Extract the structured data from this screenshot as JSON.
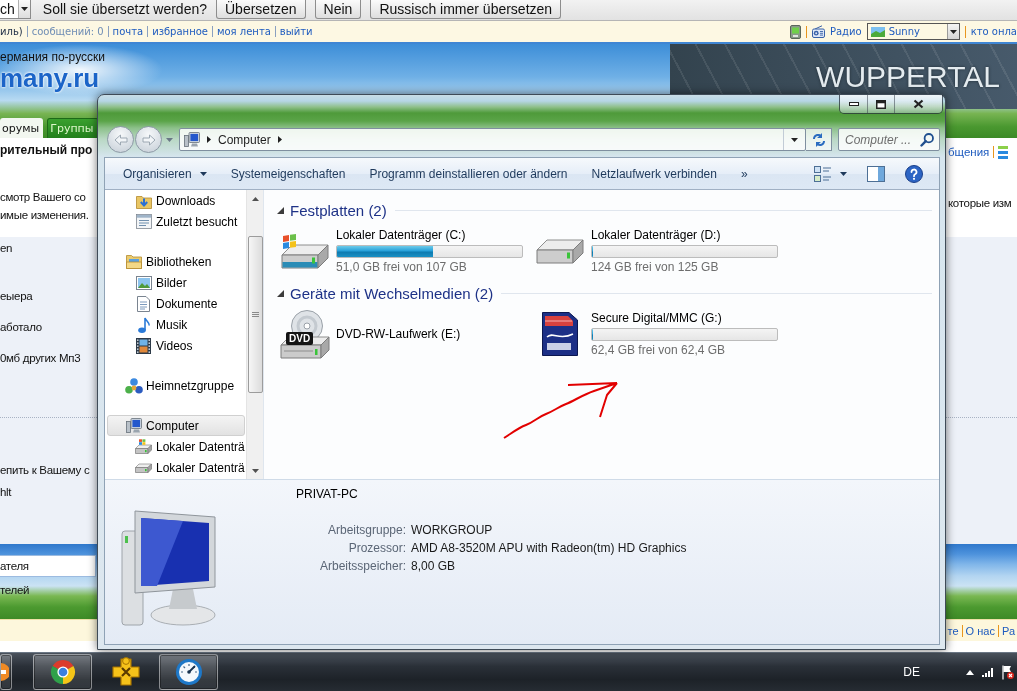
{
  "translate_bar": {
    "language": "ch",
    "question": "Soll sie übersetzt werden?",
    "buttons": [
      "Übersetzen",
      "Nein",
      "Russisch immer übersetzen"
    ]
  },
  "user_bar": {
    "links": [
      {
        "text": "иль)",
        "kind": "plain"
      },
      {
        "text": "сообщений: 0",
        "kind": "muted"
      },
      {
        "text": "почта",
        "kind": "link"
      },
      {
        "text": "избранное",
        "kind": "link"
      },
      {
        "text": "моя лента",
        "kind": "link"
      },
      {
        "text": "выйти",
        "kind": "link"
      }
    ],
    "radio": "Радио",
    "weather": "Sunny",
    "online": "кто онла"
  },
  "site_header": {
    "tagline": "ермания по-русски",
    "logo": "many.ru",
    "banner": "WUPPERTAL"
  },
  "site_tabs": [
    {
      "label": "орумы",
      "selected": true
    },
    {
      "label": "Группы",
      "selected": false
    }
  ],
  "page": {
    "heading": "рительный про",
    "messages_link": "бщения",
    "intro_lines": [
      "смотр Вашего со",
      "имые изменения."
    ],
    "intro_right": "которые изм",
    "post_lines": [
      "en",
      "еыера",
      "аботало",
      "0мб других Мп3"
    ],
    "note_lines": [
      "епить к Вашему с",
      "hlt"
    ],
    "field_value": "ателя",
    "band_text": "телей",
    "footer_links": [
      "те",
      "О нас",
      "Ра"
    ]
  },
  "explorer": {
    "nav_buttons": [
      {
        "kind": "back",
        "disabled": true
      },
      {
        "kind": "forward",
        "disabled": true
      }
    ],
    "breadcrumbs": [
      "Computer"
    ],
    "search": {
      "placeholder": "Computer ..."
    },
    "toolbar": {
      "commands": [
        {
          "label": "Organisieren",
          "kind": "menu"
        },
        {
          "label": "Systemeigenschaften",
          "kind": "command"
        },
        {
          "label": "Programm deinstallieren oder ändern",
          "kind": "command"
        },
        {
          "label": "Netzlaufwerk verbinden",
          "kind": "command"
        }
      ],
      "overflow": "»"
    },
    "nav": {
      "leading_items": [
        {
          "label": "Downloads",
          "kind": "downloads",
          "selected": false
        },
        {
          "label": "Zuletzt besucht",
          "kind": "recent",
          "selected": false
        }
      ],
      "sections": [
        {
          "label": "Bibliotheken",
          "kind": "library",
          "selected": false,
          "children": [
            {
              "label": "Bilder",
              "kind": "pictures",
              "selected": false
            },
            {
              "label": "Dokumente",
              "kind": "documents",
              "selected": false
            },
            {
              "label": "Musik",
              "kind": "music",
              "selected": false
            },
            {
              "label": "Videos",
              "kind": "videos",
              "selected": false
            }
          ]
        },
        {
          "label": "Heimnetzgruppe",
          "kind": "homegroup",
          "selected": false
        },
        {
          "label": "Computer",
          "kind": "computer",
          "selected": true,
          "children": [
            {
              "label": "Lokaler Datenträ",
              "kind": "system-drive",
              "selected": false
            },
            {
              "label": "Lokaler Datenträ",
              "kind": "drive",
              "selected": false
            }
          ]
        }
      ]
    },
    "groups": [
      {
        "title": "Festplatten (2)",
        "expanded": true,
        "items": [
          {
            "name": "Lokaler Datenträger (C:)",
            "kind": "system-drive",
            "level": 0.52,
            "free": "51,0 GB frei von 107 GB"
          },
          {
            "name": "Lokaler Datenträger (D:)",
            "kind": "drive",
            "level": 0,
            "free": "124 GB frei von 125 GB"
          }
        ]
      },
      {
        "title": "Geräte mit Wechselmedien (2)",
        "expanded": true,
        "items": [
          {
            "name": "DVD-RW-Laufwerk (E:)",
            "kind": "dvd",
            "badge": "DVD"
          },
          {
            "name": "Secure Digital/MMC (G:)",
            "kind": "sd-card",
            "level": 0,
            "free": "62,4 GB frei von 62,4 GB"
          }
        ]
      }
    ],
    "details": {
      "name": "PRIVAT-PC",
      "fields": [
        {
          "label": "Arbeitsgruppe:",
          "value": "WORKGROUP"
        },
        {
          "label": "Prozessor:",
          "value": "AMD A8-3520M APU with Radeon(tm) HD Graphics"
        },
        {
          "label": "Arbeitsspeicher:",
          "value": "8,00 GB"
        }
      ]
    }
  },
  "taskbar": {
    "apps": [
      {
        "kind": "cut-off",
        "running": true
      },
      {
        "kind": "ring-logo",
        "running": true
      },
      {
        "kind": "puzzle",
        "running": false
      },
      {
        "kind": "gauge",
        "running": true
      }
    ],
    "language": "DE"
  }
}
